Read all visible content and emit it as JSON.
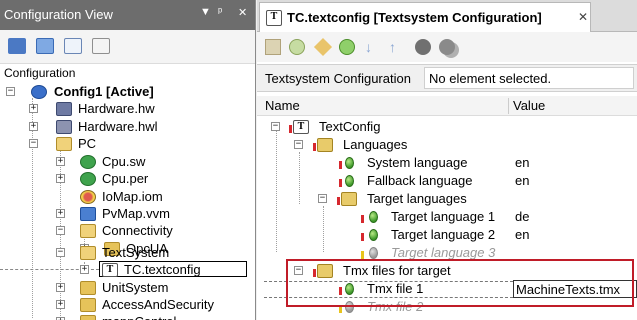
{
  "left_panel": {
    "title": "Configuration View",
    "title_buttons": [
      "▼",
      "ᵖ",
      "✕"
    ],
    "root_label": "Configuration",
    "tree": [
      {
        "key": "config1",
        "label": "Config1 [Active]",
        "icon": "config-icon",
        "bold": true
      },
      {
        "key": "hardware_hw",
        "label": "Hardware.hw",
        "icon": "hardware-icon"
      },
      {
        "key": "hardware_hwl",
        "label": "Hardware.hwl",
        "icon": "hardware-list-icon"
      },
      {
        "key": "pc",
        "label": "PC",
        "icon": "folder-icon"
      },
      {
        "key": "cpu_sw",
        "label": "Cpu.sw",
        "icon": "software-icon"
      },
      {
        "key": "cpu_per",
        "label": "Cpu.per",
        "icon": "software-icon"
      },
      {
        "key": "iomap",
        "label": "IoMap.iom",
        "icon": "iomap-icon"
      },
      {
        "key": "pvmap",
        "label": "PvMap.vvm",
        "icon": "pvmap-icon"
      },
      {
        "key": "connectivity",
        "label": "Connectivity",
        "icon": "folder-icon"
      },
      {
        "key": "opcua",
        "label": "OpcUA",
        "icon": "folder-icon"
      },
      {
        "key": "textsystem",
        "label": "TextSystem",
        "icon": "folder-icon"
      },
      {
        "key": "tc_textconfig",
        "label": "TC.textconfig",
        "icon": "textconfig-icon"
      },
      {
        "key": "unitsystem",
        "label": "UnitSystem",
        "icon": "folder-icon"
      },
      {
        "key": "accessandsecurity",
        "label": "AccessAndSecurity",
        "icon": "folder-icon"
      },
      {
        "key": "mappcontrol",
        "label": "mappControl",
        "icon": "folder-icon"
      }
    ]
  },
  "editor": {
    "tab_title": "TC.textconfig [Textsystem Configuration]",
    "tab_close": "✕",
    "section_label": "Textsystem Configuration",
    "status": "No element selected.",
    "col_name": "Name",
    "col_value": "Value",
    "rows": [
      {
        "key": "textconfig",
        "name": "TextConfig",
        "value": ""
      },
      {
        "key": "languages",
        "name": "Languages",
        "value": ""
      },
      {
        "key": "system_language",
        "name": "System language",
        "value": "en"
      },
      {
        "key": "fallback_language",
        "name": "Fallback language",
        "value": "en"
      },
      {
        "key": "target_languages",
        "name": "Target languages",
        "value": ""
      },
      {
        "key": "target_language_1",
        "name": "Target language 1",
        "value": "de"
      },
      {
        "key": "target_language_2",
        "name": "Target language 2",
        "value": "en"
      },
      {
        "key": "target_language_3",
        "name": "Target language 3",
        "value": ""
      },
      {
        "key": "tmx_files",
        "name": "Tmx files for target",
        "value": ""
      },
      {
        "key": "tmx_file_1",
        "name": "Tmx file 1",
        "value": "MachineTexts.tmx"
      },
      {
        "key": "tmx_file_2",
        "name": "Tmx file 2",
        "value": ""
      }
    ]
  },
  "colors": {
    "title_bar": "#6d6d6d",
    "highlight_border": "#c01c28",
    "leaf_green": "#3e9a2a",
    "required_marker": "#d6282e"
  }
}
